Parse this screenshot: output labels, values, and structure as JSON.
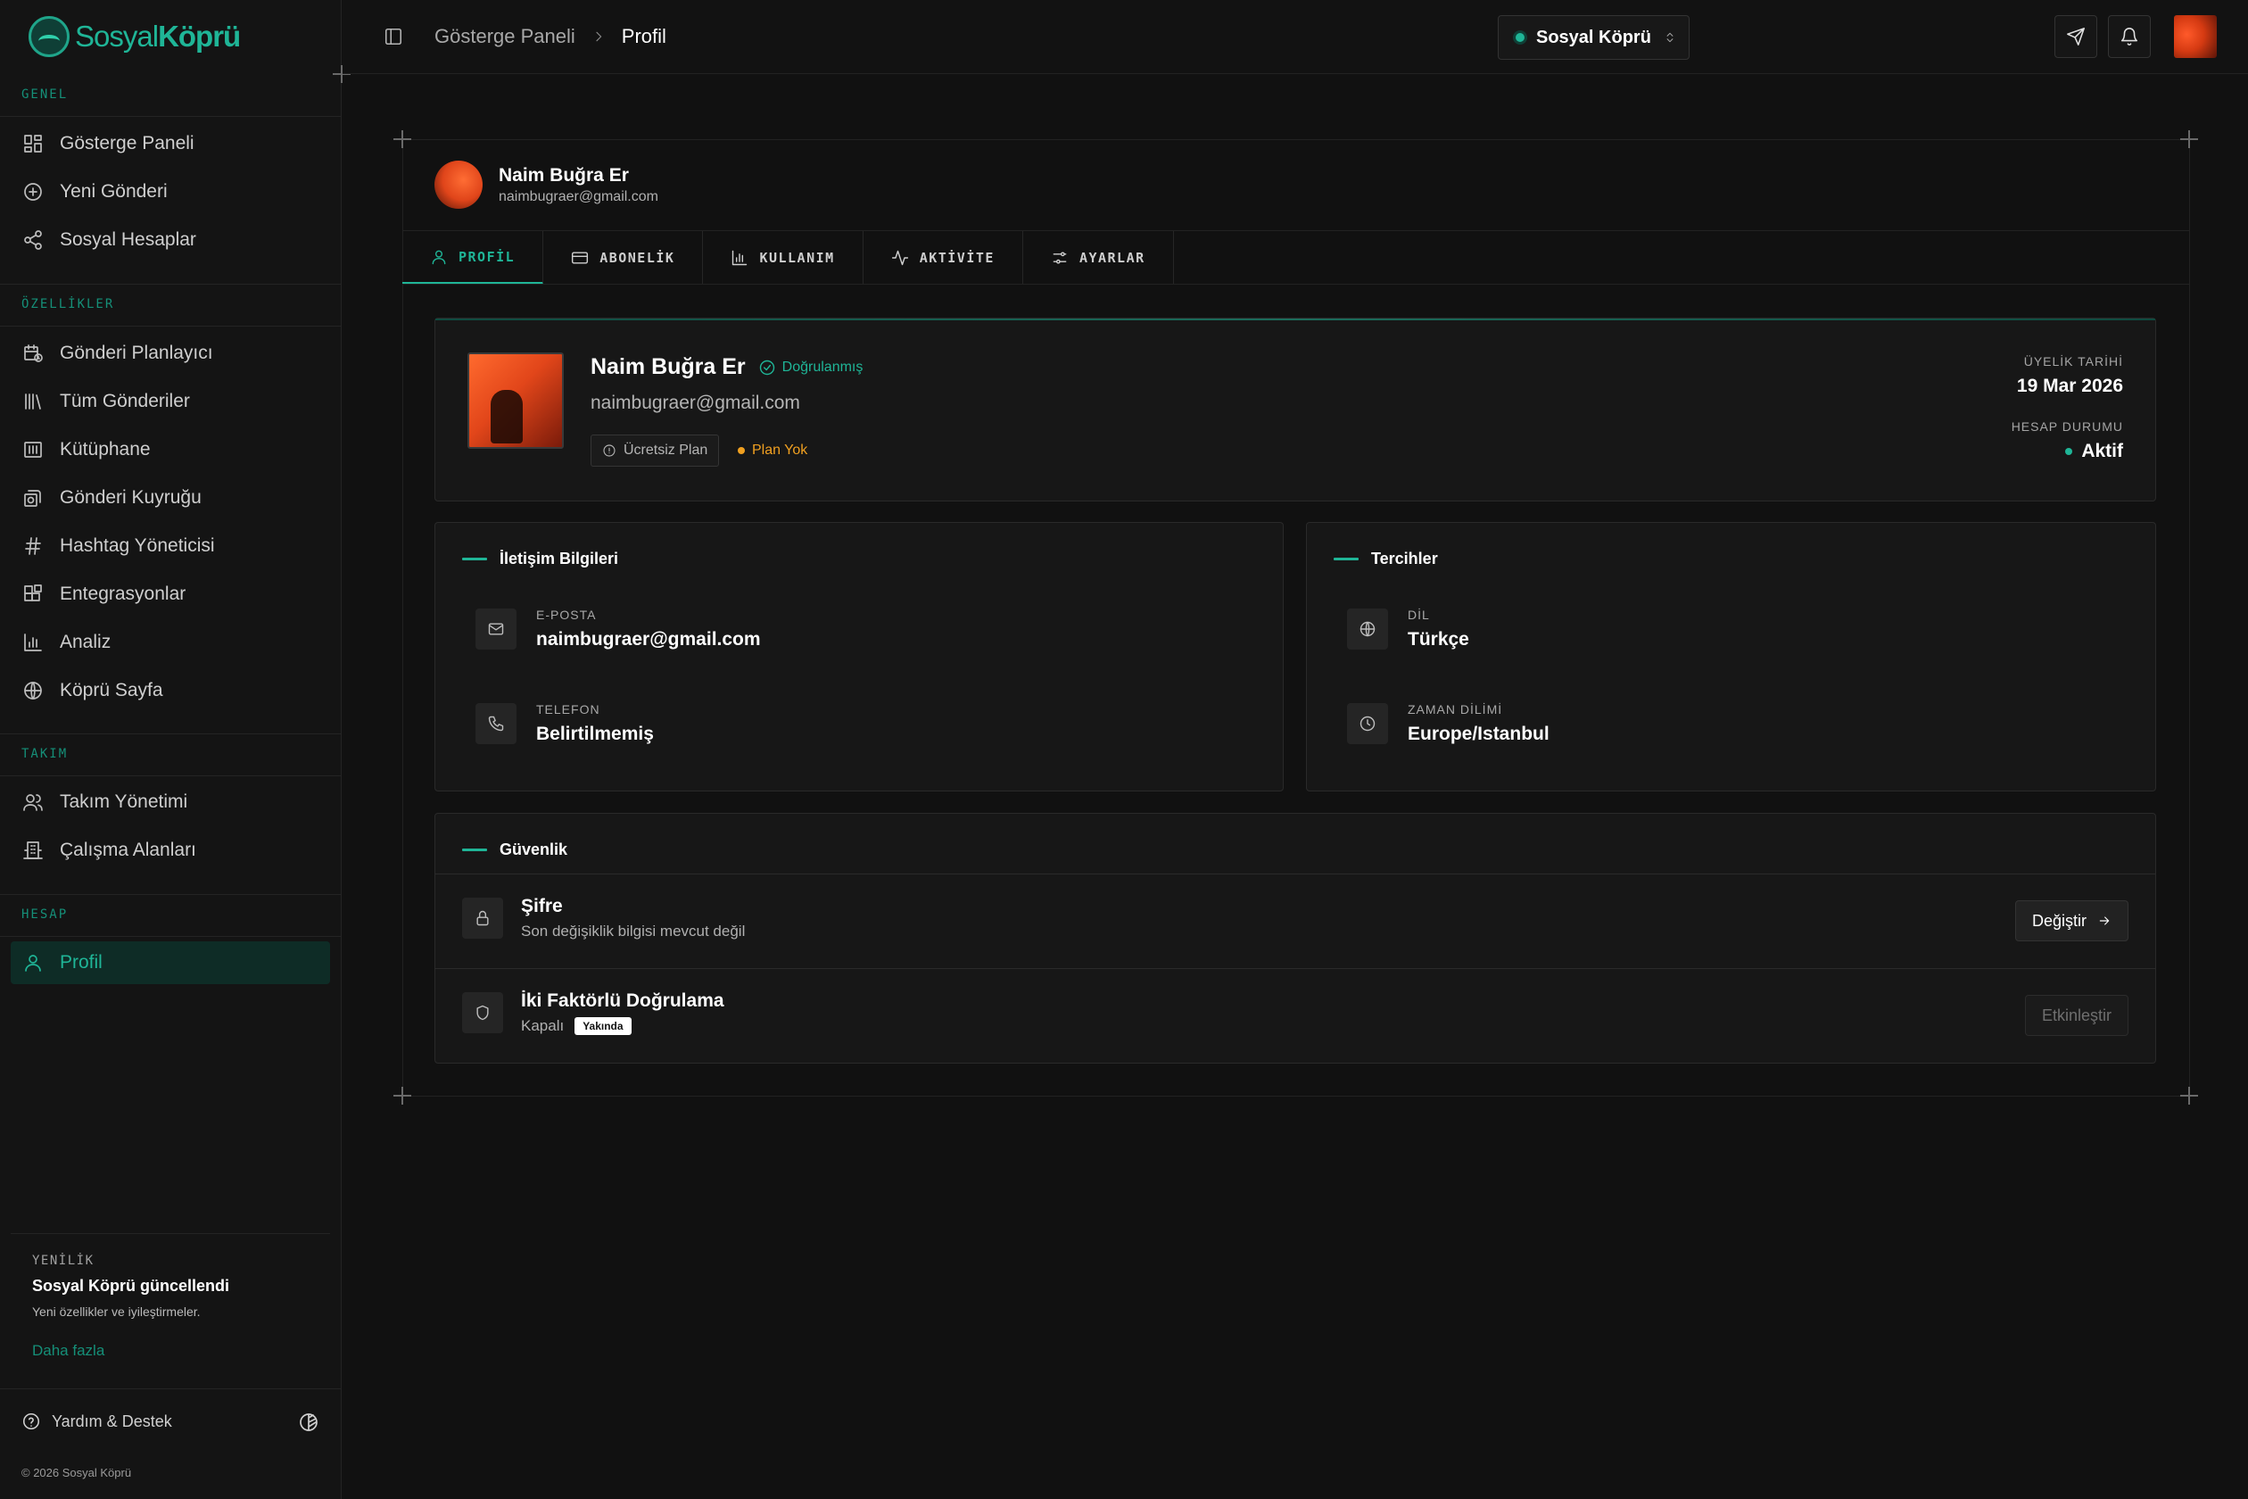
{
  "brand": {
    "name_light": "Sosyal",
    "name_bold": "Köprü",
    "accent": "#1fb597"
  },
  "sidebar": {
    "sections": [
      {
        "label": "GENEL",
        "items": [
          {
            "label": "Gösterge Paneli",
            "icon": "dashboard-icon"
          },
          {
            "label": "Yeni Gönderi",
            "icon": "plus-circle-icon"
          },
          {
            "label": "Sosyal Hesaplar",
            "icon": "share-icon"
          }
        ]
      },
      {
        "label": "ÖZELLİKLER",
        "items": [
          {
            "label": "Gönderi Planlayıcı",
            "icon": "calendar-clock-icon"
          },
          {
            "label": "Tüm Gönderiler",
            "icon": "library-icon"
          },
          {
            "label": "Kütüphane",
            "icon": "archive-icon"
          },
          {
            "label": "Gönderi Kuyruğu",
            "icon": "queue-icon"
          },
          {
            "label": "Hashtag Yöneticisi",
            "icon": "hash-icon"
          },
          {
            "label": "Entegrasyonlar",
            "icon": "blocks-icon"
          },
          {
            "label": "Analiz",
            "icon": "bar-chart-icon"
          },
          {
            "label": "Köprü Sayfa",
            "icon": "globe-icon"
          }
        ]
      },
      {
        "label": "TAKIM",
        "items": [
          {
            "label": "Takım Yönetimi",
            "icon": "users-icon"
          },
          {
            "label": "Çalışma Alanları",
            "icon": "building-icon"
          }
        ]
      },
      {
        "label": "HESAP",
        "items": [
          {
            "label": "Profil",
            "icon": "user-icon",
            "active": true
          }
        ]
      }
    ],
    "news": {
      "tag": "YENİLİK",
      "title": "Sosyal Köprü güncellendi",
      "desc": "Yeni özellikler ve iyileştirmeler.",
      "link": "Daha fazla"
    },
    "help": "Yardım & Destek",
    "copyright": "© 2026 Sosyal Köprü"
  },
  "topbar": {
    "breadcrumb": [
      "Gösterge Paneli",
      "Profil"
    ],
    "workspace": "Sosyal Köprü"
  },
  "profile_header": {
    "name": "Naim Buğra Er",
    "email": "naimbugraer@gmail.com"
  },
  "tabs": [
    {
      "label": "PROFİL",
      "icon": "user-icon",
      "active": true
    },
    {
      "label": "ABONELİK",
      "icon": "credit-card-icon"
    },
    {
      "label": "KULLANIM",
      "icon": "bar-chart-icon"
    },
    {
      "label": "AKTİVİTE",
      "icon": "activity-icon"
    },
    {
      "label": "AYARLAR",
      "icon": "sliders-icon"
    }
  ],
  "hero": {
    "name": "Naim Buğra Er",
    "verified": "Doğrulanmış",
    "email": "naimbugraer@gmail.com",
    "plan": "Ücretsiz Plan",
    "plan_status": "Plan Yok",
    "member_since_label": "ÜYELİK TARİHİ",
    "member_since": "19 Mar 2026",
    "account_status_label": "HESAP DURUMU",
    "account_status": "Aktif"
  },
  "contact": {
    "title": "İletişim Bilgileri",
    "email_label": "E-POSTA",
    "email": "naimbugraer@gmail.com",
    "phone_label": "TELEFON",
    "phone": "Belirtilmemiş"
  },
  "preferences": {
    "title": "Tercihler",
    "lang_label": "DİL",
    "lang": "Türkçe",
    "tz_label": "ZAMAN DİLİMİ",
    "tz": "Europe/Istanbul"
  },
  "security": {
    "title": "Güvenlik",
    "password_title": "Şifre",
    "password_sub": "Son değişiklik bilgisi mevcut değil",
    "password_btn": "Değiştir",
    "twofa_title": "İki Faktörlü Doğrulama",
    "twofa_status": "Kapalı",
    "twofa_badge": "Yakında",
    "twofa_btn": "Etkinleştir"
  }
}
